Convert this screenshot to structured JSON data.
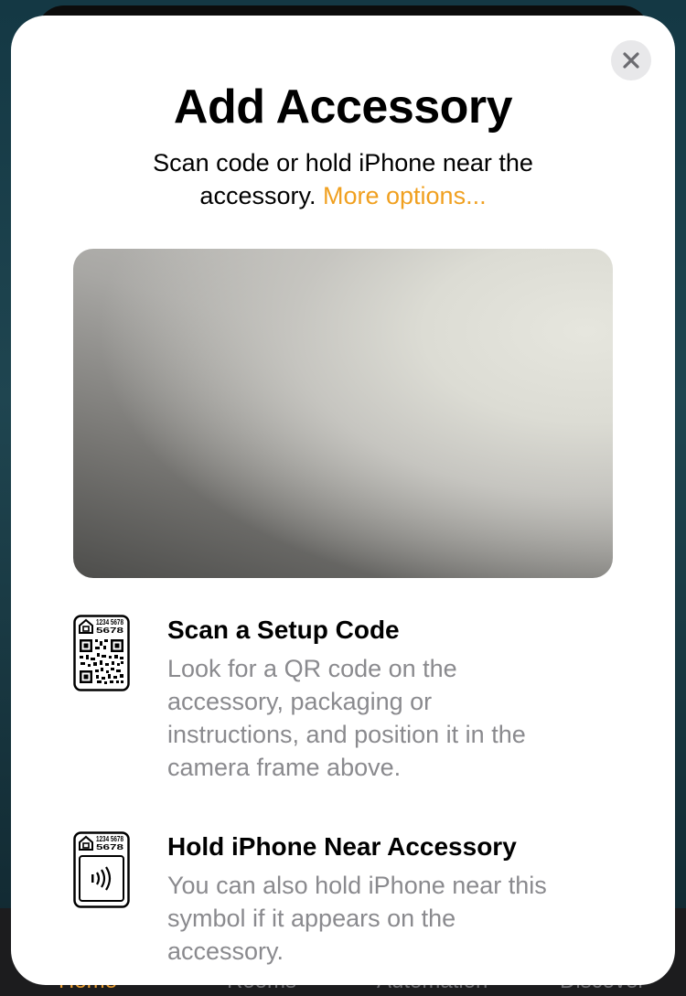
{
  "sheet": {
    "title": "Add Accessory",
    "subtitle": "Scan code or hold iPhone near the accessory.",
    "more_options": "More options...",
    "close_icon": "xmark-icon"
  },
  "options": [
    {
      "title": "Scan a Setup Code",
      "description": "Look for a QR code on the accessory, packaging or instructions, and position it in the camera frame above.",
      "icon": "qr-setup-code-icon",
      "code": "1234 5678"
    },
    {
      "title": "Hold iPhone Near Accessory",
      "description": "You can also hold iPhone near this symbol if it appears on the accessory.",
      "icon": "nfc-tag-icon",
      "code": "1234 5678"
    }
  ],
  "background_tabs": [
    "Home",
    "Rooms",
    "Automation",
    "Discover"
  ],
  "colors": {
    "accent": "#f0a020",
    "secondary_text": "#8a8a8e",
    "sheet_background": "#ffffff"
  }
}
